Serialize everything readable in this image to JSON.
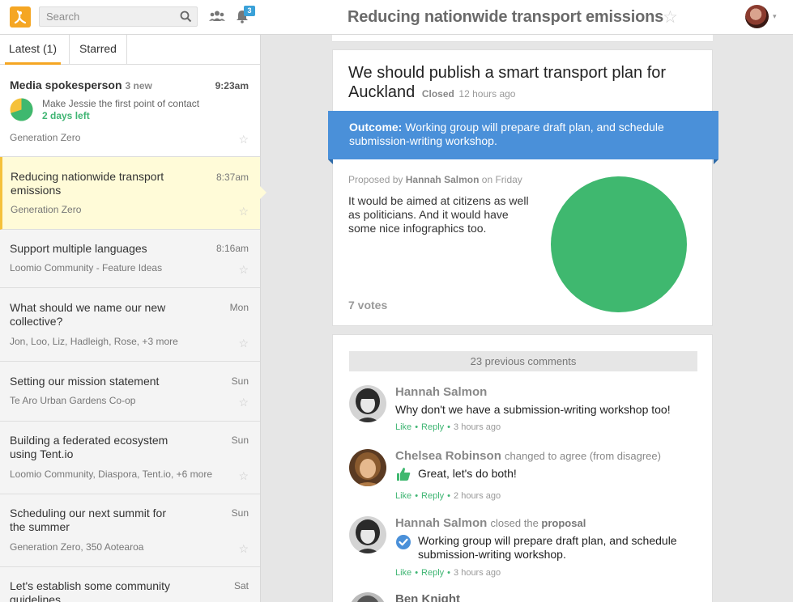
{
  "header": {
    "search_placeholder": "Search",
    "notification_count": "3",
    "title": "Reducing nationwide transport emissions",
    "title_star": "☆",
    "avatar_caret": "▾"
  },
  "sidebar": {
    "tabs": [
      {
        "label": "Latest (1)"
      },
      {
        "label": "Starred"
      }
    ],
    "items": [
      {
        "title": "Media spokesperson",
        "new_count": "3 new",
        "time": "9:23am",
        "proposal_text": "Make Jessie the first point of contact",
        "days_left": "2 days left",
        "pie_fraction": 0.7,
        "group": "Generation Zero",
        "star": "☆"
      },
      {
        "title": "Reducing nationwide transport emissions",
        "time": "8:37am",
        "group": "Generation Zero",
        "star": "☆"
      },
      {
        "title": "Support multiple languages",
        "time": "8:16am",
        "group": "Loomio Community - Feature Ideas",
        "star": "☆"
      },
      {
        "title": "What should we name our new collective?",
        "time": "Mon",
        "group": "Jon, Loo, Liz, Hadleigh, Rose, +3 more",
        "star": "☆"
      },
      {
        "title": "Setting our mission statement",
        "time": "Sun",
        "group": "Te Aro Urban Gardens Co-op",
        "star": "☆"
      },
      {
        "title": "Building a federated ecosystem using Tent.io",
        "time": "Sun",
        "group": "Loomio Community, Diaspora, Tent.io, +6 more",
        "star": "☆"
      },
      {
        "title": "Scheduling our next summit for the summer",
        "time": "Sun",
        "group": "Generation Zero, 350 Aotearoa",
        "star": "☆"
      },
      {
        "title": "Let's establish some community guidelines",
        "time": "Sat",
        "group": "",
        "star": ""
      }
    ]
  },
  "proposal": {
    "title": "We should publish a smart transport plan for Auckland",
    "status": "Closed",
    "closed_time": "12 hours ago",
    "outcome_label": "Outcome:",
    "outcome_text": "Working group will prepare draft plan, and schedule submission-writing workshop.",
    "proposed_prefix": "Proposed by",
    "proposer": "Hannah Salmon",
    "proposed_suffix": "on Friday",
    "description": "It would be aimed at citizens as well as politicians. And it would have some nice infographics too.",
    "votes": "7 votes",
    "pie_color": "#3fb86f"
  },
  "comments": {
    "previous": "23 previous comments",
    "items": [
      {
        "author": "Hannah Salmon",
        "action": "",
        "action_bold": "",
        "body": "Why don't we have a submission-writing workshop too!",
        "like": "Like",
        "reply": "Reply",
        "time": "3 hours ago"
      },
      {
        "author": "Chelsea Robinson",
        "action": "changed to agree (from disagree)",
        "action_bold": "",
        "body": "Great, let's do both!",
        "like": "Like",
        "reply": "Reply",
        "time": "2 hours ago"
      },
      {
        "author": "Hannah Salmon",
        "action": "closed the",
        "action_bold": "proposal",
        "body": "Working group will prepare draft plan, and schedule submission-writing workshop.",
        "like": "Like",
        "reply": "Reply",
        "time": "3 hours ago"
      },
      {
        "author": "Ben Knight",
        "action": "",
        "action_bold": "",
        "body": "",
        "like": "",
        "reply": "",
        "time": ""
      }
    ]
  },
  "colors": {
    "accent": "#f5a623",
    "outcome_blue": "#4a90d9",
    "agree_green": "#3fb86f"
  }
}
